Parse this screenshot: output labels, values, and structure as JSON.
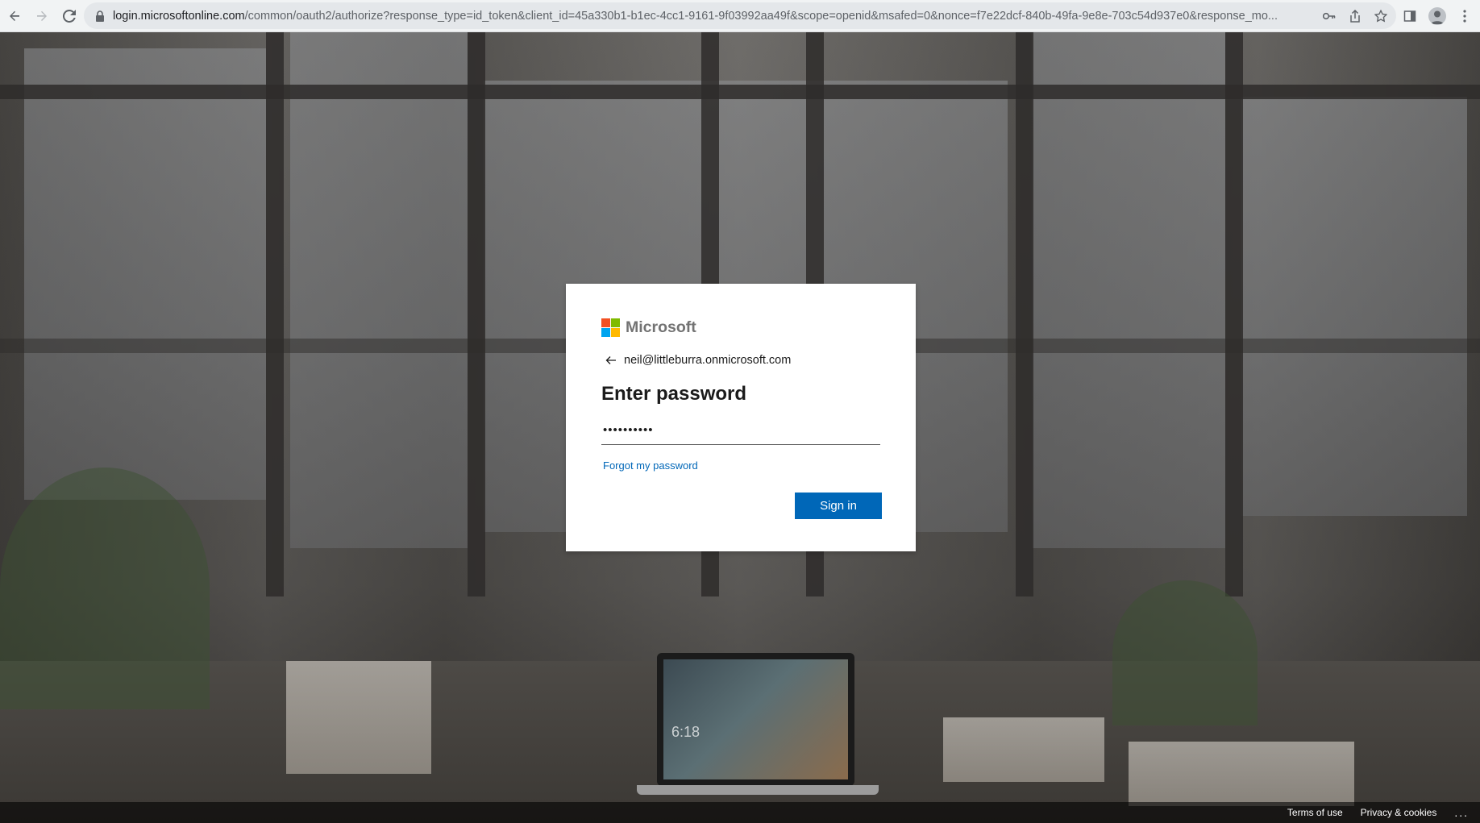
{
  "browser": {
    "url_host": "login.microsoftonline.com",
    "url_path": "/common/oauth2/authorize?response_type=id_token&client_id=45a330b1-b1ec-4cc1-9161-9f03992aa49f&scope=openid&msafed=0&nonce=f7e22dcf-840b-49fa-9e8e-703c54d937e0&response_mo...",
    "icons": [
      "back-arrow-icon",
      "forward-arrow-icon",
      "reload-icon",
      "lock-icon",
      "key-icon",
      "share-icon",
      "star-icon",
      "side-panel-icon",
      "profile-icon",
      "more-vert-icon"
    ]
  },
  "background": {
    "laptop_time": "6:18"
  },
  "login": {
    "brand_name": "Microsoft",
    "brand_colors": [
      "#f25022",
      "#7fba00",
      "#00a4ef",
      "#ffb900"
    ],
    "identity": "neil@littleburra.onmicrosoft.com",
    "title": "Enter password",
    "password_value": "••••••••••",
    "forgot_link": "Forgot my password",
    "signin_label": "Sign in"
  },
  "footer": {
    "terms": "Terms of use",
    "privacy": "Privacy & cookies",
    "more": "..."
  }
}
